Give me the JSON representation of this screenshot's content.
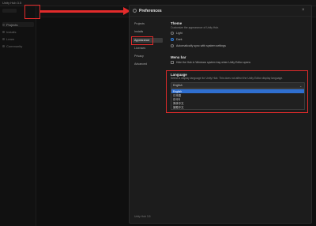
{
  "app": {
    "title": "Unity Hub 3.5",
    "accent_color": "#2f7fe0",
    "annotation_color": "#e32b2b"
  },
  "sidebar": {
    "items": [
      {
        "label": "Projects",
        "icon": "cube-icon"
      },
      {
        "label": "Installs",
        "icon": "download-icon"
      },
      {
        "label": "Learn",
        "icon": "graduation-cap-icon"
      },
      {
        "label": "Community",
        "icon": "people-icon"
      }
    ]
  },
  "preferences": {
    "title": "Preferences",
    "close_glyph": "×",
    "gear_icon": "gear-icon",
    "nav": [
      {
        "label": "Projects",
        "active": false
      },
      {
        "label": "Installs",
        "active": false
      },
      {
        "label": "Appearance",
        "active": true
      },
      {
        "label": "Licenses",
        "active": false
      },
      {
        "label": "Privacy",
        "active": false
      },
      {
        "label": "Advanced",
        "active": false
      }
    ],
    "version": "Unity Hub 3.5",
    "theme": {
      "title": "Theme",
      "subtitle": "Customize the appearance of Unity Hub.",
      "options": [
        {
          "label": "Light",
          "selected": false
        },
        {
          "label": "Dark",
          "selected": true
        },
        {
          "label": "Automatically sync with system settings",
          "selected": false
        }
      ]
    },
    "menu_bar": {
      "title": "Menu bar",
      "checkbox_label": "Hide the Hub in Windows system tray when Unity Editor opens"
    },
    "language": {
      "title": "Language",
      "subtitle": "Select a display language for Unity Hub. This does not affect the Unity Editor display language.",
      "selected": "English",
      "chevron": "⌄",
      "options": [
        "English",
        "日本語",
        "한국어",
        "简体中文",
        "繁體中文"
      ],
      "highlighted_index": 0
    }
  }
}
